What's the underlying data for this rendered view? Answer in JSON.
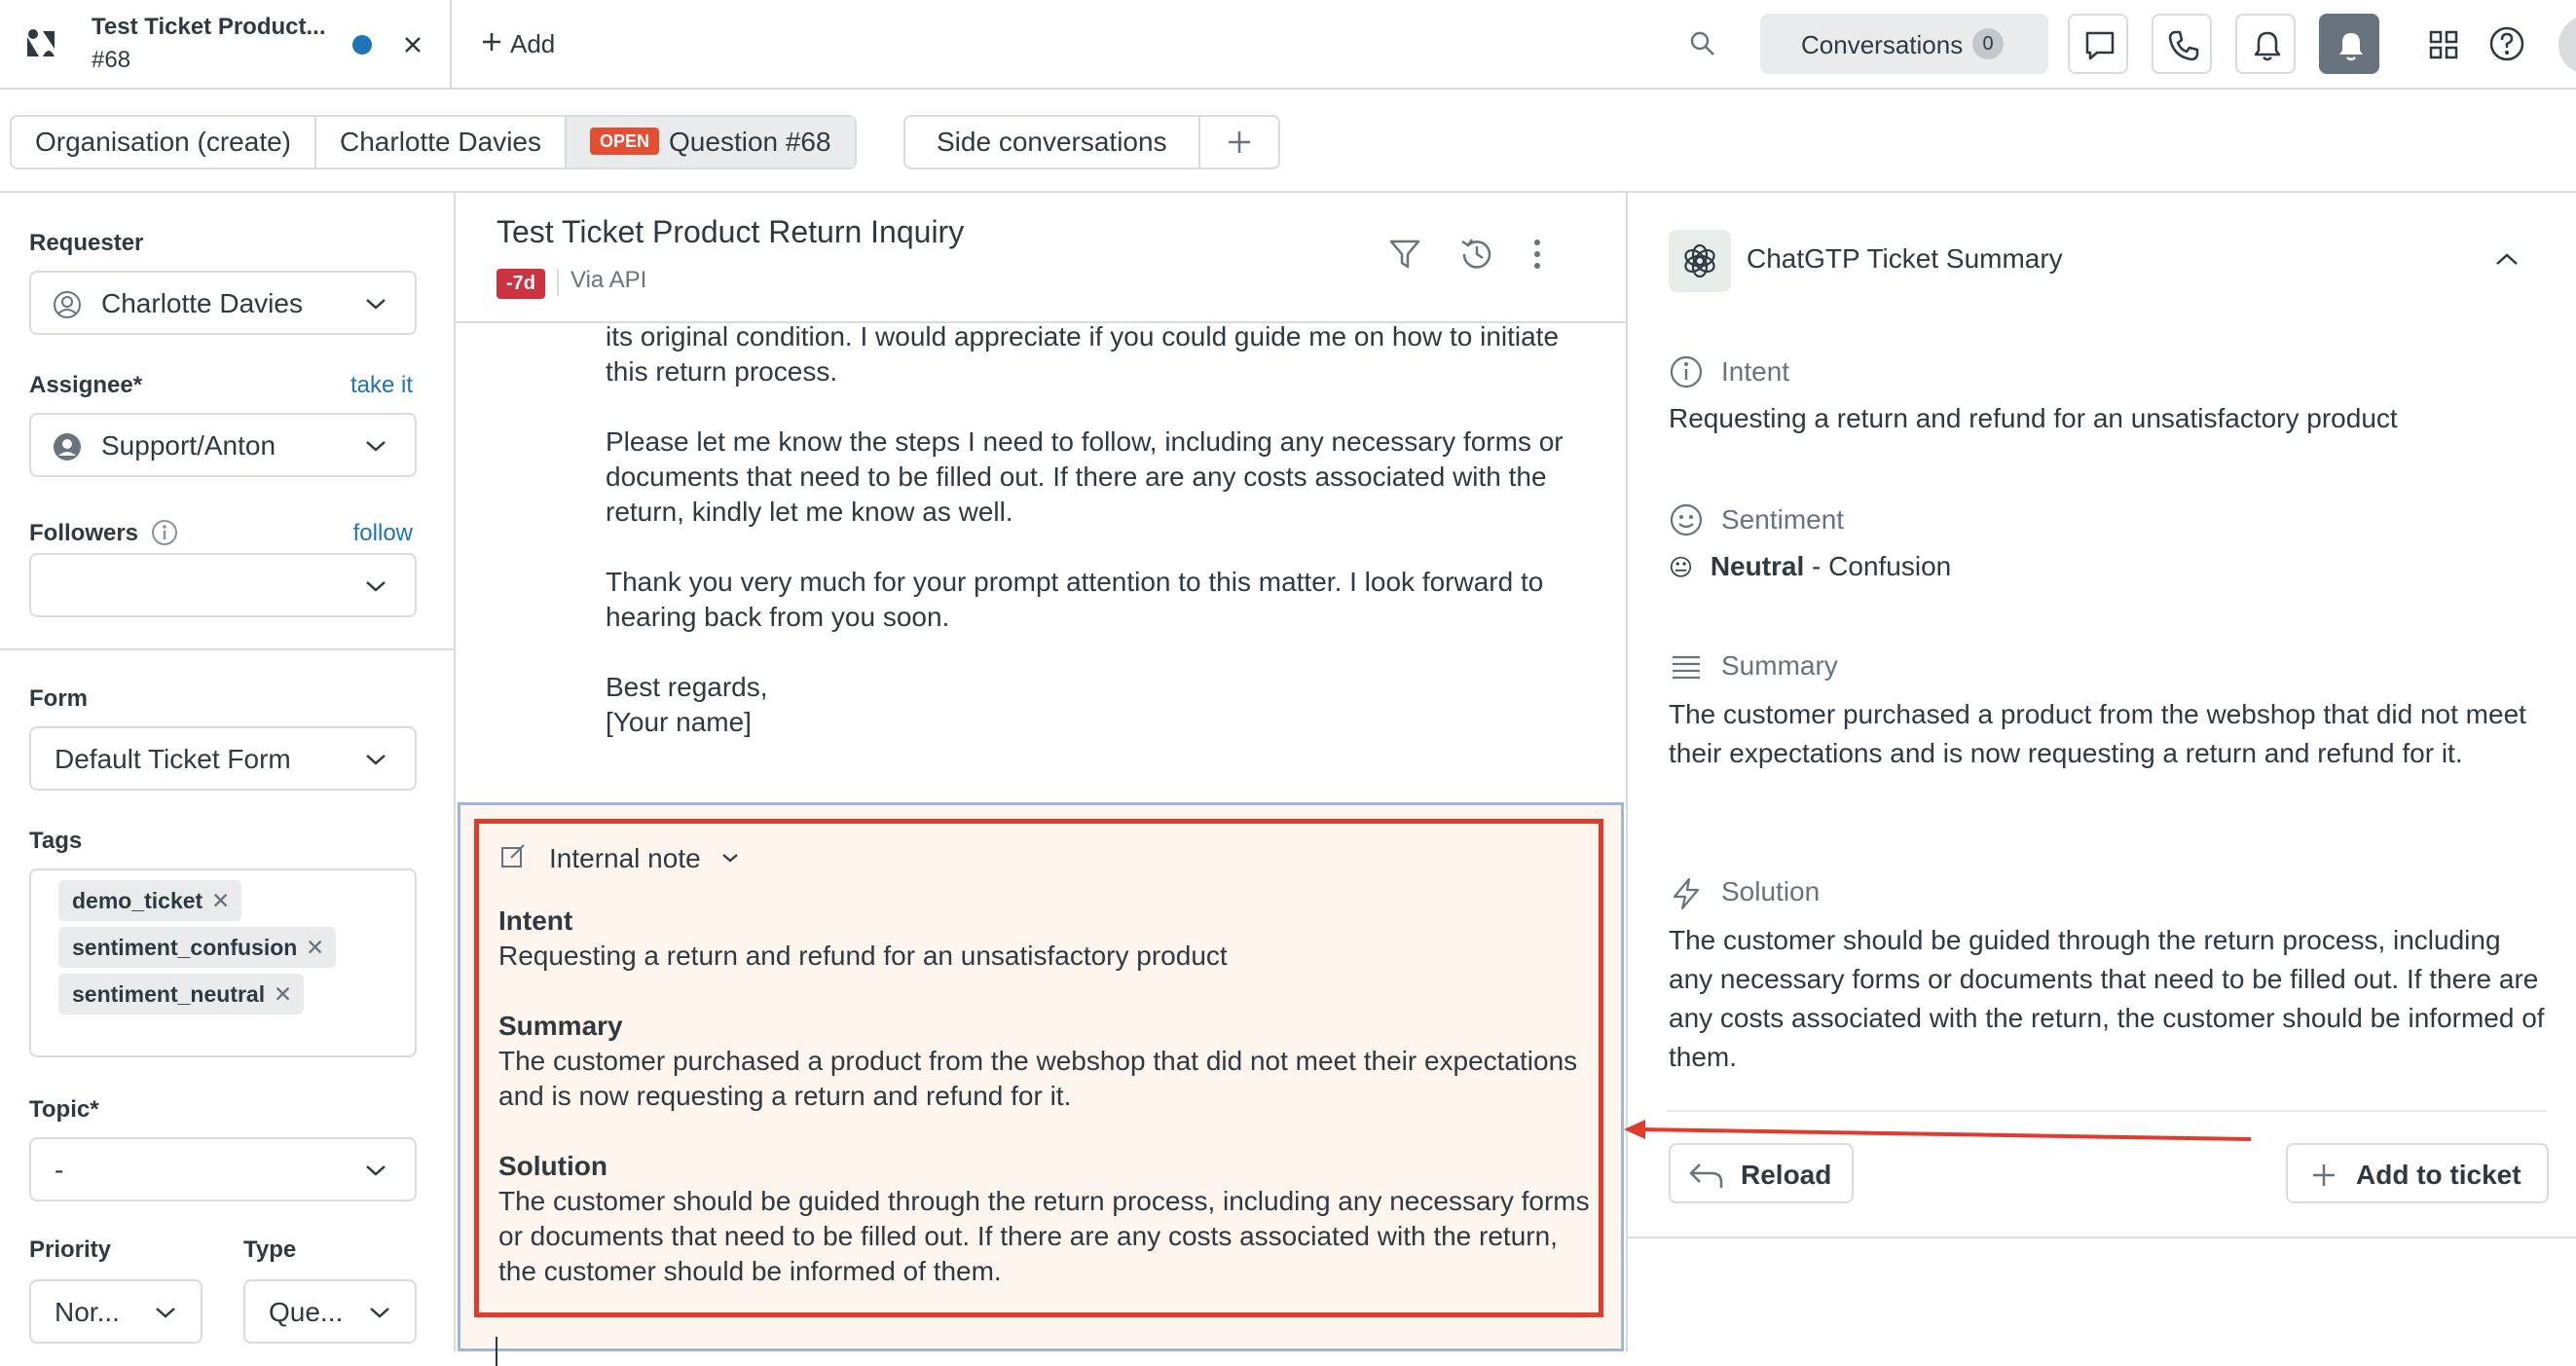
{
  "topbar": {
    "tab_title": "Test Ticket Product...",
    "tab_subtitle": "#68",
    "add_label": "Add",
    "conversations_label": "Conversations",
    "conversations_count": "0"
  },
  "subtabs": {
    "organisation": "Organisation (create)",
    "requester_tab": "Charlotte Davies",
    "status_badge": "OPEN",
    "question": "Question #68",
    "side_conversations": "Side conversations"
  },
  "sidebar": {
    "requester_label": "Requester",
    "requester_value": "Charlotte Davies",
    "assignee_label": "Assignee*",
    "assignee_link": "take it",
    "assignee_value": "Support/Anton",
    "followers_label": "Followers",
    "followers_link": "follow",
    "followers_value": "",
    "form_label": "Form",
    "form_value": "Default Ticket Form",
    "tags_label": "Tags",
    "tags": [
      "demo_ticket",
      "sentiment_confusion",
      "sentiment_neutral"
    ],
    "topic_label": "Topic*",
    "topic_value": "-",
    "priority_label": "Priority",
    "priority_value": "Nor...",
    "type_label": "Type",
    "type_value": "Que..."
  },
  "ticket": {
    "title": "Test Ticket Product Return Inquiry",
    "age": "-7d",
    "via": "Via API",
    "message_p1": "its original condition. I would appreciate if you could guide me on how to initiate this return process.",
    "message_p2": "Please let me know the steps I need to follow, including any necessary forms or documents that need to be filled out. If there are any costs associated with the return, kindly let me know as well.",
    "message_p3": "Thank you very much for your prompt attention to this matter. I look forward to hearing back from you soon.",
    "message_sign1": "Best regards,",
    "message_sign2": "[Your name]"
  },
  "compose": {
    "mode": "Internal note",
    "intent_h": "Intent",
    "intent_t": "Requesting a return and refund for an unsatisfactory product",
    "summary_h": "Summary",
    "summary_t": "The customer purchased a product from the webshop that did not meet their expectations and is now requesting a return and refund for it.",
    "solution_h": "Solution",
    "solution_t": "The customer should be guided through the return process, including any necessary forms or documents that need to be filled out. If there are any costs associated with the return, the customer should be informed of them."
  },
  "app": {
    "title": "ChatGTP Ticket Summary",
    "intent_h": "Intent",
    "intent_t": "Requesting a return and refund for an unsatisfactory product",
    "sentiment_h": "Sentiment",
    "sentiment_emoji": "😐",
    "sentiment_bold": "Neutral",
    "sentiment_rest": " - Confusion",
    "summary_h": "Summary",
    "summary_t": "The customer purchased a product from the webshop that did not meet their expectations and is now requesting a return and refund for it.",
    "solution_h": "Solution",
    "solution_t": "The customer should be guided through the return process, including any necessary forms or documents that need to be filled out. If there are any costs associated with the return, the customer should be informed of them.",
    "reload_label": "Reload",
    "add_label": "Add to ticket"
  },
  "colors": {
    "accent_blue": "#1f73b7",
    "annotation_red": "#e03c2e",
    "open_badge": "#e34f32",
    "age_badge": "#cc3340",
    "note_bg": "#fdf5ee"
  }
}
